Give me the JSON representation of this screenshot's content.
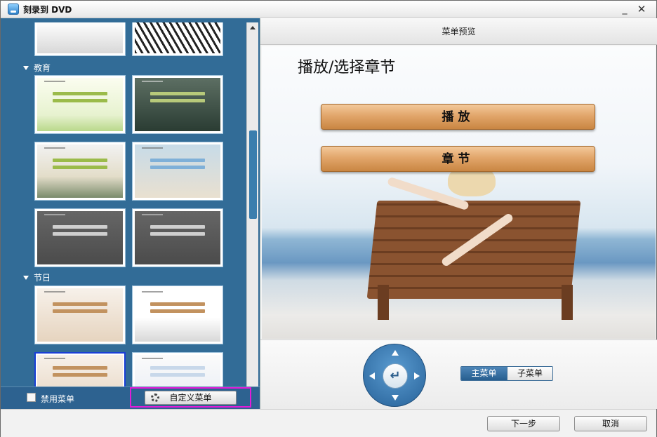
{
  "window": {
    "title": "刻录到 DVD",
    "minimize_glyph": "_",
    "close_glyph": "✕",
    "icon": "disc-icon"
  },
  "left_panel": {
    "sections": [
      {
        "label": "教育"
      },
      {
        "label": "节日"
      }
    ],
    "disable_menu_label": "禁用菜单",
    "disable_menu_checked": false,
    "custom_menu_button": "自定义菜单"
  },
  "preview": {
    "header": "菜单预览",
    "title": "播放/选择章节",
    "buttons": [
      "播放",
      "章节"
    ]
  },
  "controls": {
    "enter_glyph": "↵",
    "tabs": [
      {
        "label": "主菜单",
        "active": true
      },
      {
        "label": "子菜单",
        "active": false
      }
    ]
  },
  "footer": {
    "next": "下一步",
    "cancel": "取消"
  }
}
